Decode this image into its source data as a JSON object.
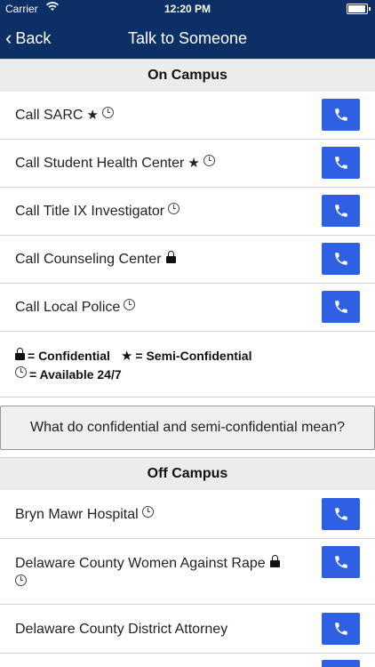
{
  "status_bar": {
    "carrier": "Carrier",
    "time": "12:20 PM",
    "battery_level": 0.95
  },
  "nav": {
    "back_label": "Back",
    "title": "Talk to Someone"
  },
  "on_campus": {
    "header": "On Campus",
    "items": [
      {
        "label": "Call SARC",
        "icons": [
          "star-icon",
          "clock-icon"
        ]
      },
      {
        "label": "Call Student Health Center",
        "icons": [
          "star-icon",
          "clock-icon"
        ]
      },
      {
        "label": "Call Title IX Investigator",
        "icons": [
          "clock-icon"
        ]
      },
      {
        "label": "Call Counseling Center",
        "icons": [
          "lock-icon"
        ]
      },
      {
        "label": "Call Local Police",
        "icons": [
          "clock-icon"
        ]
      }
    ]
  },
  "legend": {
    "confidential": "= Confidential",
    "star_glyph": "★",
    "semi_confidential": "= Semi-Confidential",
    "available": "= Available 24/7"
  },
  "info_button": {
    "label": "What do confidential and semi-confidential mean?"
  },
  "off_campus": {
    "header": "Off Campus",
    "items": [
      {
        "label": "Bryn Mawr Hospital",
        "icons": [
          "clock-icon"
        ]
      },
      {
        "label": "Delaware County Women Against Rape",
        "icons": [
          "lock-icon",
          "clock-icon"
        ]
      },
      {
        "label": "Delaware County District Attorney",
        "icons": []
      }
    ]
  },
  "colors": {
    "nav_bg": "#0c2f66",
    "call_button": "#2f5fe3"
  },
  "icon_glyph": {
    "star": "★",
    "back": "‹"
  }
}
